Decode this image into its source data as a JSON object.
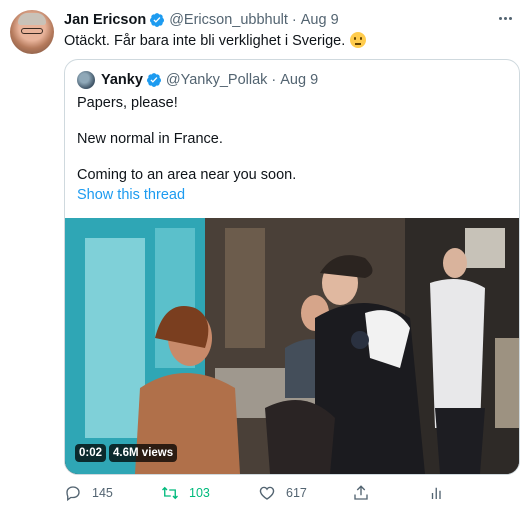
{
  "tweet": {
    "author_name": "Jan Ericson",
    "author_handle": "@Ericson_ubbhult",
    "separator": "·",
    "date": "Aug 9",
    "text": "Otäckt. Får bara inte bli verklighet i Sverige.",
    "emoji": "slightly-frowning-face"
  },
  "quoted": {
    "author_name": "Yanky",
    "author_handle": "@Yanky_Pollak",
    "date": "Aug 9",
    "lines": [
      "Papers, please!",
      "New normal in France.",
      "Coming to an area near you soon."
    ],
    "show_thread": "Show this thread",
    "video": {
      "duration": "0:02",
      "views": "4.6M views"
    }
  },
  "actions": {
    "reply_count": "145",
    "retweet_count": "103",
    "like_count": "617"
  },
  "colors": {
    "link": "#1d9bf0",
    "retweet_active": "#00ba7c",
    "muted": "#536471",
    "text": "#0f1419",
    "border": "#cfd9de",
    "verified": "#1d9bf0"
  }
}
